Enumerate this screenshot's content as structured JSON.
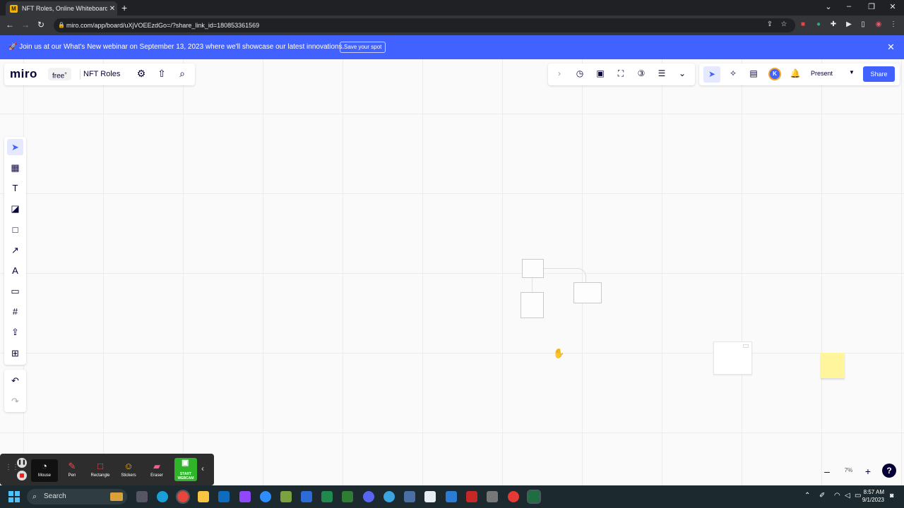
{
  "browser": {
    "tab_title": "NFT Roles, Online Whiteboard fo",
    "url": "miro.com/app/board/uXjVOEEzdGo=/?share_link_id=180853361569"
  },
  "banner": {
    "text": "🚀 Join us at our What's New webinar on September 13, 2023 where we'll showcase our latest innovations.",
    "button": "Save your spot",
    "close": "✕"
  },
  "board": {
    "logo": "miro",
    "plan": "free",
    "name": "NFT Roles"
  },
  "top_right": {
    "avatar_initial": "K",
    "present_label": "Present",
    "share_label": "Share"
  },
  "zoom": {
    "minus": "–",
    "value": "7%",
    "plus": "+",
    "help": "?"
  },
  "recorder": {
    "tools": [
      {
        "label": "Mouse",
        "icon": "mouse-icon"
      },
      {
        "label": "Pen",
        "icon": "pen-icon"
      },
      {
        "label": "Rectangle",
        "icon": "rectangle-icon"
      },
      {
        "label": "Stickers",
        "icon": "sticker-icon"
      },
      {
        "label": "Eraser",
        "icon": "eraser-icon"
      }
    ],
    "webcam_label": "START WEBCAM"
  },
  "taskbar": {
    "search_placeholder": "Search",
    "time": "8:57 AM",
    "date": "9/1/2023"
  },
  "colors": {
    "accent": "#4262ff",
    "banner": "#4262ff",
    "sticky": "#fff59d",
    "taskbar": "#1c2a2f"
  }
}
